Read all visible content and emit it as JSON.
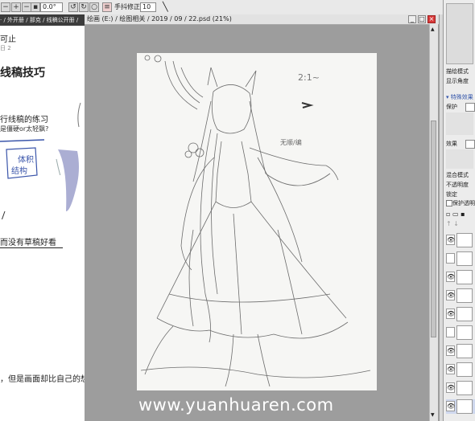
{
  "toolbar": {
    "rotation_value": "0.0°",
    "stabilizer_label": "手抖修正",
    "stabilizer_value": "10"
  },
  "left_doc": {
    "tabs_text": "· / 外开册 / 那克 / 线稿公开册 /",
    "stub_top": "可止",
    "stub_date": "日 2",
    "heading": "线稿技巧",
    "line1": "行线稿的练习",
    "line2": "是僵硬or太轻飘?",
    "handwritten_1": "体积",
    "handwritten_2": "结构",
    "underlined": "而没有草稿好看",
    "bottom_line": "，但是画面却比自己的想"
  },
  "canvas_window": {
    "title": "绘画 (E:) / 绘图相关 / 2019 / 09 / 22.psd (21%)",
    "sketch_notes": [
      "2:1~",
      "无顺/编"
    ]
  },
  "right_panel": {
    "label_1": "描绘模式",
    "label_2": "显示角度",
    "section": "▾ 特殊效果",
    "protect_label": "保护",
    "effect_label": "效果",
    "blend_label": "混合模式",
    "opacity_label": "不透明度",
    "lock_label": "锁定",
    "transparent_label": "保护透明",
    "layers": [
      "",
      "",
      "",
      "",
      "",
      "",
      "",
      "",
      "",
      "",
      ""
    ]
  },
  "watermark": "www.yuanhuaren.com"
}
